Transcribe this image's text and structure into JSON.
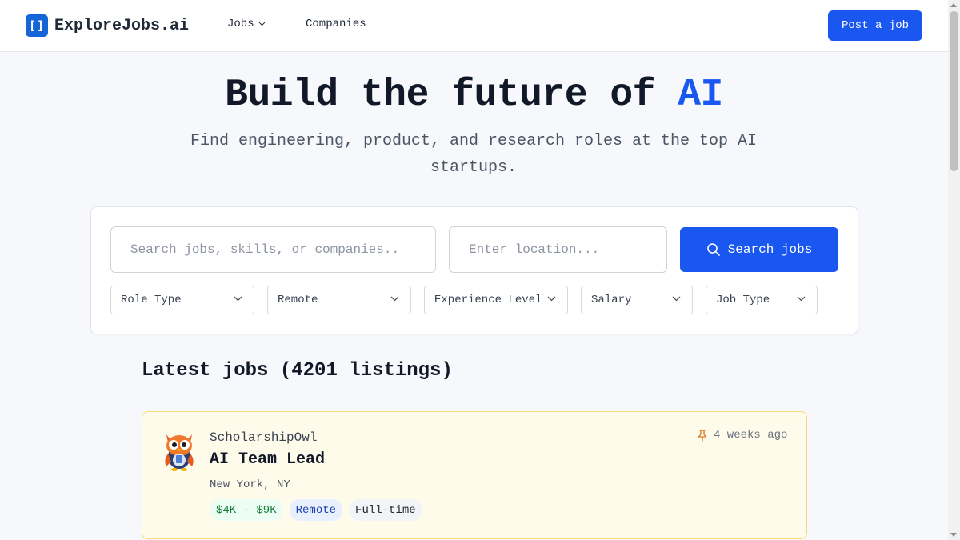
{
  "nav": {
    "logo_glyph": "[]",
    "logo_text": "ExploreJobs.ai",
    "jobs_label": "Jobs",
    "companies_label": "Companies",
    "post_job_label": "Post a job"
  },
  "hero": {
    "title_prefix": "Build the future of ",
    "title_accent": "AI",
    "subtitle": "Find engineering, product, and research roles at the top AI startups."
  },
  "search": {
    "query_placeholder": "Search jobs, skills, or companies..",
    "query_value": "",
    "location_placeholder": "Enter location...",
    "location_value": "",
    "button_label": "Search jobs",
    "filters": [
      {
        "label": "Role Type"
      },
      {
        "label": "Remote"
      },
      {
        "label": "Experience Level"
      },
      {
        "label": "Salary"
      },
      {
        "label": "Job Type"
      }
    ]
  },
  "jobs": {
    "heading": "Latest jobs (4201 listings)",
    "items": [
      {
        "company": "ScholarshipOwl",
        "title": "AI Team Lead",
        "location": "New York, NY",
        "posted": "4 weeks ago",
        "pinned": true,
        "salary": "$4K - $9K",
        "remote": "Remote",
        "type": "Full-time",
        "logo_icon": "owl-mascot-icon"
      }
    ]
  },
  "colors": {
    "accent": "#1a56f0",
    "pinned_card_bg": "#fffbeb",
    "pinned_card_border": "#f7d97a",
    "salary_tag": "#15803d",
    "remote_tag": "#1e40af"
  }
}
